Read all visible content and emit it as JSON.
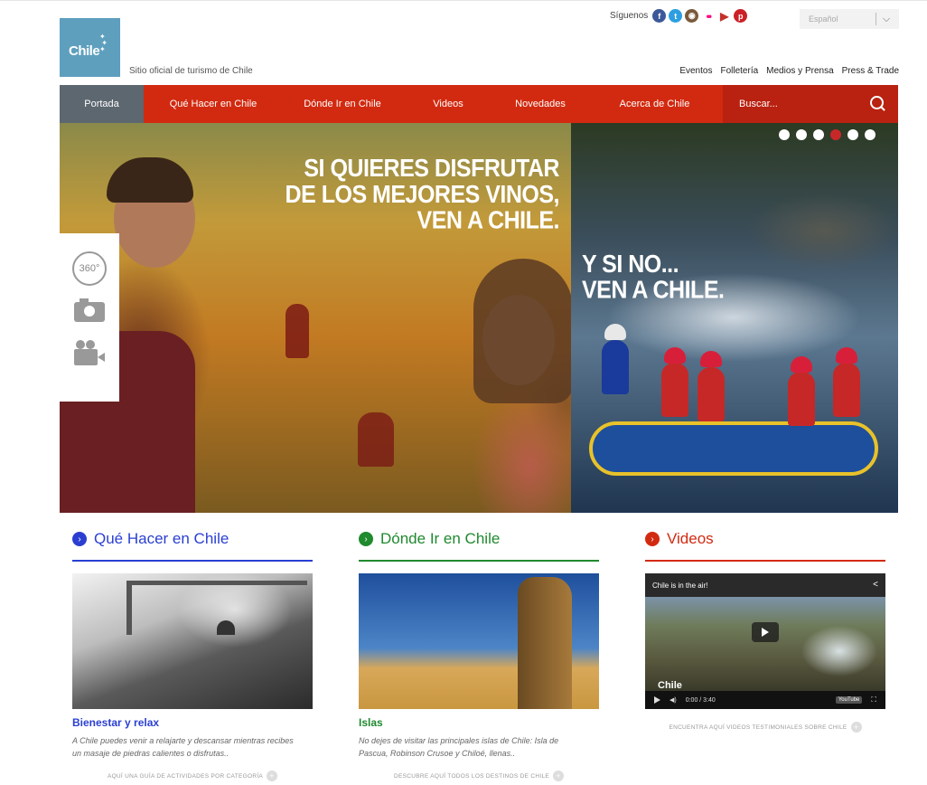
{
  "header": {
    "logo_text": "Chile",
    "tagline": "Sitio oficial de turismo de Chile",
    "follow_label": "Síguenos",
    "language": "Español",
    "top_links": [
      "Eventos",
      "Folletería",
      "Medios y Prensa",
      "Press & Trade"
    ]
  },
  "nav": {
    "items": [
      "Portada",
      "Qué Hacer en Chile",
      "Dónde Ir en Chile",
      "Videos",
      "Novedades",
      "Acerca de Chile"
    ],
    "search_placeholder": "Buscar..."
  },
  "hero": {
    "left_text": [
      "SI QUIERES DISFRUTAR",
      "DE LOS MEJORES VINOS,",
      "VEN A CHILE."
    ],
    "right_text": [
      "Y SI NO...",
      "VEN A CHILE."
    ],
    "slide_count": 6,
    "active_slide": 4,
    "tool_360": "360°"
  },
  "columns": [
    {
      "title": "Qué Hacer en Chile",
      "color": "#2a3fd1",
      "subtitle": "Bienestar y relax",
      "description": "A Chile puedes venir a relajarte y descansar mientras recibes un masaje de piedras calientes o disfrutas..",
      "more": "AQUÍ UNA GUÍA DE ACTIVIDADES POR CATEGORÍA"
    },
    {
      "title": "Dónde Ir en Chile",
      "color": "#1f8a2e",
      "subtitle": "Islas",
      "description": "No dejes de visitar las principales islas de Chile: Isla de Pascua, Robinson Crusoe y Chiloé, llenas..",
      "more": "DESCUBRE AQUÍ TODOS LOS DESTINOS DE CHILE"
    },
    {
      "title": "Videos",
      "color": "#d22a10",
      "more": "ENCUENTRA AQUÍ VIDEOS TESTIMONIALES SOBRE CHILE",
      "video": {
        "title": "Chile is in the air!",
        "logo": "Chile",
        "time": "0:00 / 3:40",
        "badge": "YouTube"
      }
    }
  ]
}
